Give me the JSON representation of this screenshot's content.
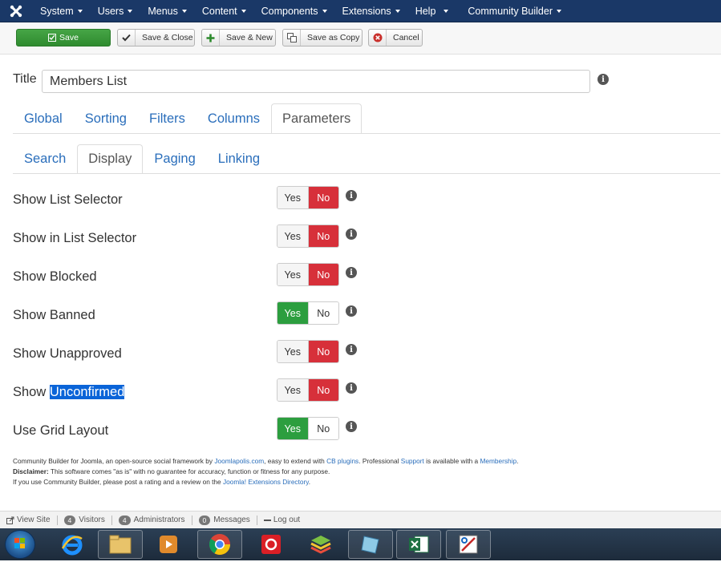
{
  "navbar": {
    "items": [
      "System",
      "Users",
      "Menus",
      "Content",
      "Components",
      "Extensions",
      "Help",
      "Community Builder"
    ]
  },
  "toolbar": {
    "save": "Save",
    "save_close": "Save & Close",
    "save_new": "Save & New",
    "save_copy": "Save as Copy",
    "cancel": "Cancel"
  },
  "form": {
    "title_label": "Title",
    "title_value": "Members List"
  },
  "tabs_main": [
    "Global",
    "Sorting",
    "Filters",
    "Columns",
    "Parameters"
  ],
  "tabs_sub": [
    "Search",
    "Display",
    "Paging",
    "Linking"
  ],
  "params": [
    {
      "label": "Show List Selector",
      "value": "No"
    },
    {
      "label": "Show in List Selector",
      "value": "No"
    },
    {
      "label": "Show Blocked",
      "value": "No"
    },
    {
      "label": "Show Banned",
      "value": "Yes"
    },
    {
      "label": "Show Unapproved",
      "value": "No"
    },
    {
      "label_prefix": "Show ",
      "label_highlight": "Unconfirmed",
      "value": "No"
    },
    {
      "label": "Use Grid Layout",
      "value": "Yes"
    }
  ],
  "toggle": {
    "yes": "Yes",
    "no": "No"
  },
  "footer": {
    "l1_a": "Community Builder for Joomla, an open-source social framework by ",
    "l1_link1": "Joomlapolis.com",
    "l1_b": ", easy to extend with ",
    "l1_link2": "CB plugins",
    "l1_c": ". Professional ",
    "l1_link3": "Support",
    "l1_d": " is available with a ",
    "l1_link4": "Membership",
    "l1_e": ".",
    "l2_bold": "Disclaimer:",
    "l2_text": " This software comes \"as is\" with no guarantee for accuracy, function or fitness for any purpose.",
    "l3_text": "If you use Community Builder, please post a rating and a review on the ",
    "l3_link": "Joomla! Extensions Directory",
    "l3_end": "."
  },
  "statusbar": {
    "view_site": "View Site",
    "visitors_count": "4",
    "visitors": "Visitors",
    "admins_count": "4",
    "admins": "Administrators",
    "messages_count": "0",
    "messages": "Messages",
    "logout": "Log out"
  },
  "colors": {
    "navbar": "#1a3867",
    "no_active": "#d7303a",
    "yes_active": "#2c9e3f",
    "link": "#2a6ebb"
  }
}
